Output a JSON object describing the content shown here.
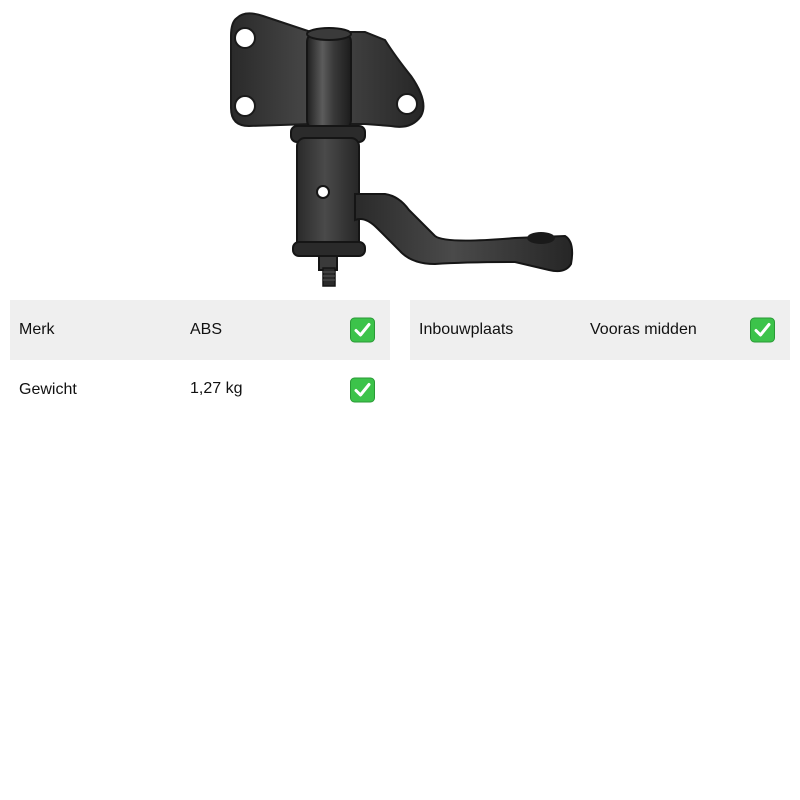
{
  "product": {
    "image_name": "idler-arm-photo"
  },
  "specs_left": [
    {
      "label": "Merk",
      "value": "ABS",
      "icon": "check-icon"
    },
    {
      "label": "Gewicht",
      "value": "1,27 kg",
      "icon": "check-icon"
    }
  ],
  "specs_right": [
    {
      "label": "Inbouwplaats",
      "value": "Vooras midden",
      "icon": "check-icon"
    }
  ],
  "colors": {
    "row_shade": "#efefef",
    "check_green": "#3cc34a"
  }
}
